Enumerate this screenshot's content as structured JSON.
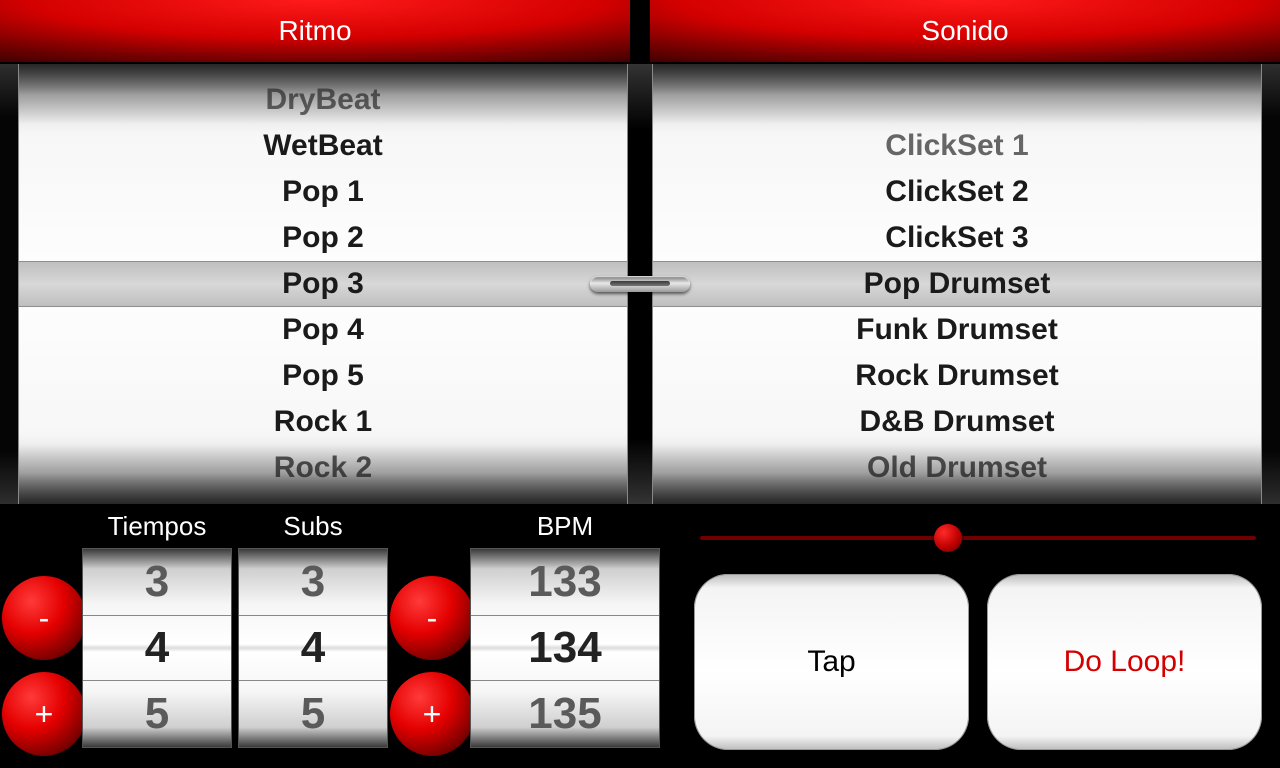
{
  "tabs": {
    "rhythm": "Ritmo",
    "sound": "Sonido"
  },
  "wheels": {
    "rhythm": {
      "items": [
        "DryBeat",
        "WetBeat",
        "Pop 1",
        "Pop 2",
        "Pop 3",
        "Pop 4",
        "Pop 5",
        "Rock 1",
        "Rock 2"
      ],
      "selectedIndex": 4
    },
    "sound": {
      "items": [
        "ClickSet 1",
        "ClickSet 2",
        "ClickSet 3",
        "Pop Drumset",
        "Funk Drumset",
        "Rock Drumset",
        "D&B Drumset",
        "Old Drumset"
      ],
      "selectedIndex": 3
    }
  },
  "controls": {
    "tiempos": {
      "label": "Tiempos",
      "values": [
        3,
        4,
        5
      ],
      "selected": 4
    },
    "subs": {
      "label": "Subs",
      "values": [
        3,
        4,
        5
      ],
      "selected": 4
    },
    "bpm": {
      "label": "BPM",
      "values": [
        133,
        134,
        135
      ],
      "selected": 134
    },
    "minus": "-",
    "plus": "+",
    "slider": {
      "position": 0.42
    },
    "tap": "Tap",
    "doloop": "Do Loop!"
  }
}
